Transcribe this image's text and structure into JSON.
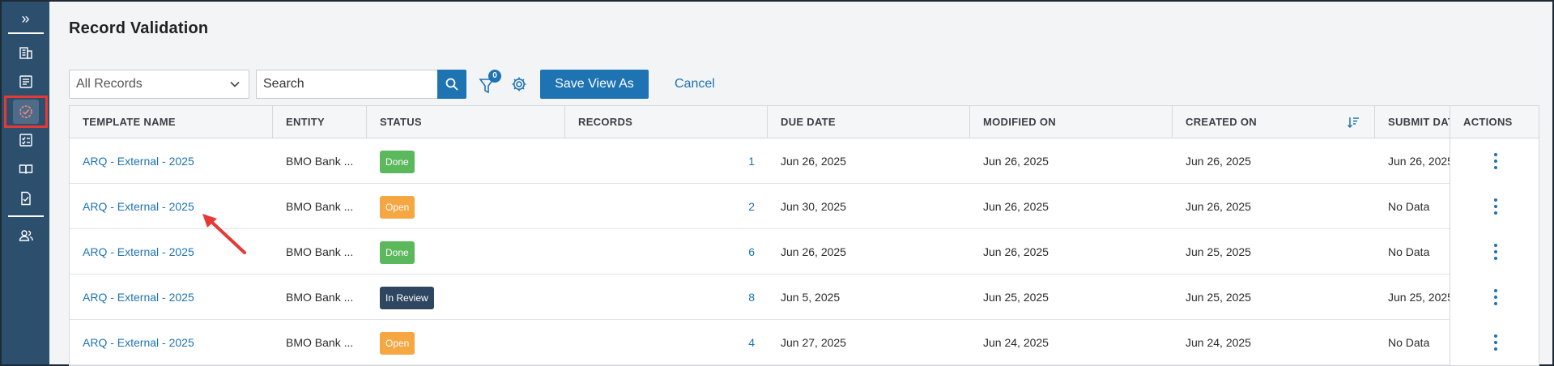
{
  "sidebar": {
    "expand_glyph": "»",
    "items": [
      {
        "icon": "building-icon"
      },
      {
        "icon": "list-icon"
      },
      {
        "icon": "validation-check-icon",
        "active": true
      },
      {
        "icon": "checklist-icon"
      },
      {
        "icon": "book-icon"
      },
      {
        "icon": "document-check-icon"
      },
      {
        "icon": "users-icon"
      }
    ]
  },
  "page": {
    "title": "Record Validation"
  },
  "toolbar": {
    "view_select": "All Records",
    "search_value": "Search",
    "filter_count": "0",
    "save_view_label": "Save View As",
    "cancel_label": "Cancel"
  },
  "table": {
    "headers": [
      "TEMPLATE NAME",
      "ENTITY",
      "STATUS",
      "RECORDS",
      "DUE DATE",
      "MODIFIED ON",
      "CREATED ON",
      "SUBMIT DATE",
      "ACTIONS"
    ],
    "rows": [
      {
        "template": "ARQ - External - 2025",
        "entity": "BMO Bank ...",
        "status": "Done",
        "records": "1",
        "due": "Jun 26, 2025",
        "modified": "Jun 26, 2025",
        "created": "Jun 26, 2025",
        "submit": "Jun 26, 2025"
      },
      {
        "template": "ARQ - External - 2025",
        "entity": "BMO Bank ...",
        "status": "Open",
        "records": "2",
        "due": "Jun 30, 2025",
        "modified": "Jun 26, 2025",
        "created": "Jun 26, 2025",
        "submit": "No Data"
      },
      {
        "template": "ARQ - External - 2025",
        "entity": "BMO Bank ...",
        "status": "Done",
        "records": "6",
        "due": "Jun 26, 2025",
        "modified": "Jun 26, 2025",
        "created": "Jun 25, 2025",
        "submit": "No Data"
      },
      {
        "template": "ARQ - External - 2025",
        "entity": "BMO Bank ...",
        "status": "In Review",
        "records": "8",
        "due": "Jun 5, 2025",
        "modified": "Jun 25, 2025",
        "created": "Jun 25, 2025",
        "submit": "Jun 25, 2025"
      },
      {
        "template": "ARQ - External - 2025",
        "entity": "BMO Bank ...",
        "status": "Open",
        "records": "4",
        "due": "Jun 27, 2025",
        "modified": "Jun 24, 2025",
        "created": "Jun 24, 2025",
        "submit": "No Data"
      }
    ]
  },
  "colors": {
    "sidebar_bg": "#2c4f6e",
    "accent": "#1e73b3",
    "status_done": "#5cb85c",
    "status_open": "#f5a742",
    "status_in_review": "#2f4660",
    "highlight": "#e53935"
  }
}
